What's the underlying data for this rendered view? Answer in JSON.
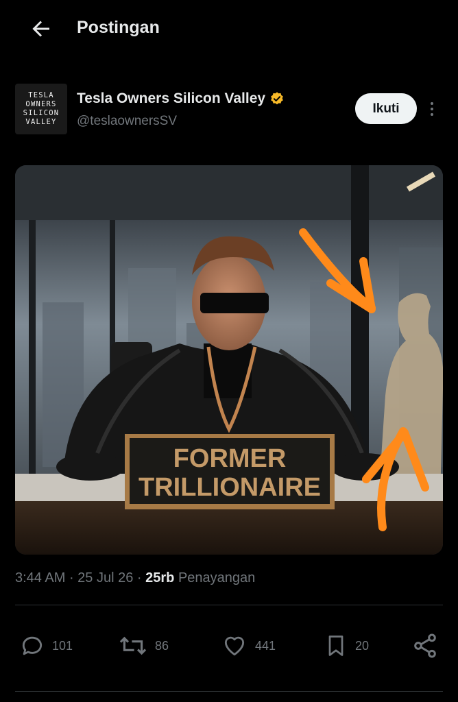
{
  "header": {
    "title": "Postingan",
    "back_icon": "arrow-left-icon"
  },
  "author": {
    "avatar_lines": [
      "TESLA",
      "OWNERS",
      "SILICON",
      "VALLEY"
    ],
    "name": "Tesla Owners Silicon Valley",
    "verified_icon": "verified-badge-icon",
    "verified_color": "#f7b928",
    "handle": "@teslaownersSV",
    "follow_label": "Ikuti"
  },
  "media": {
    "placard_line1": "FORMER",
    "placard_line2": "TRILLIONAIRE",
    "arrow_color": "#ff8a1a"
  },
  "meta": {
    "time": "3:44 AM",
    "date": "25 Jul 26",
    "views_count": "25rb",
    "views_label": "Penayangan"
  },
  "actions": {
    "replies": "101",
    "reposts": "86",
    "likes": "441",
    "bookmarks": "20"
  }
}
